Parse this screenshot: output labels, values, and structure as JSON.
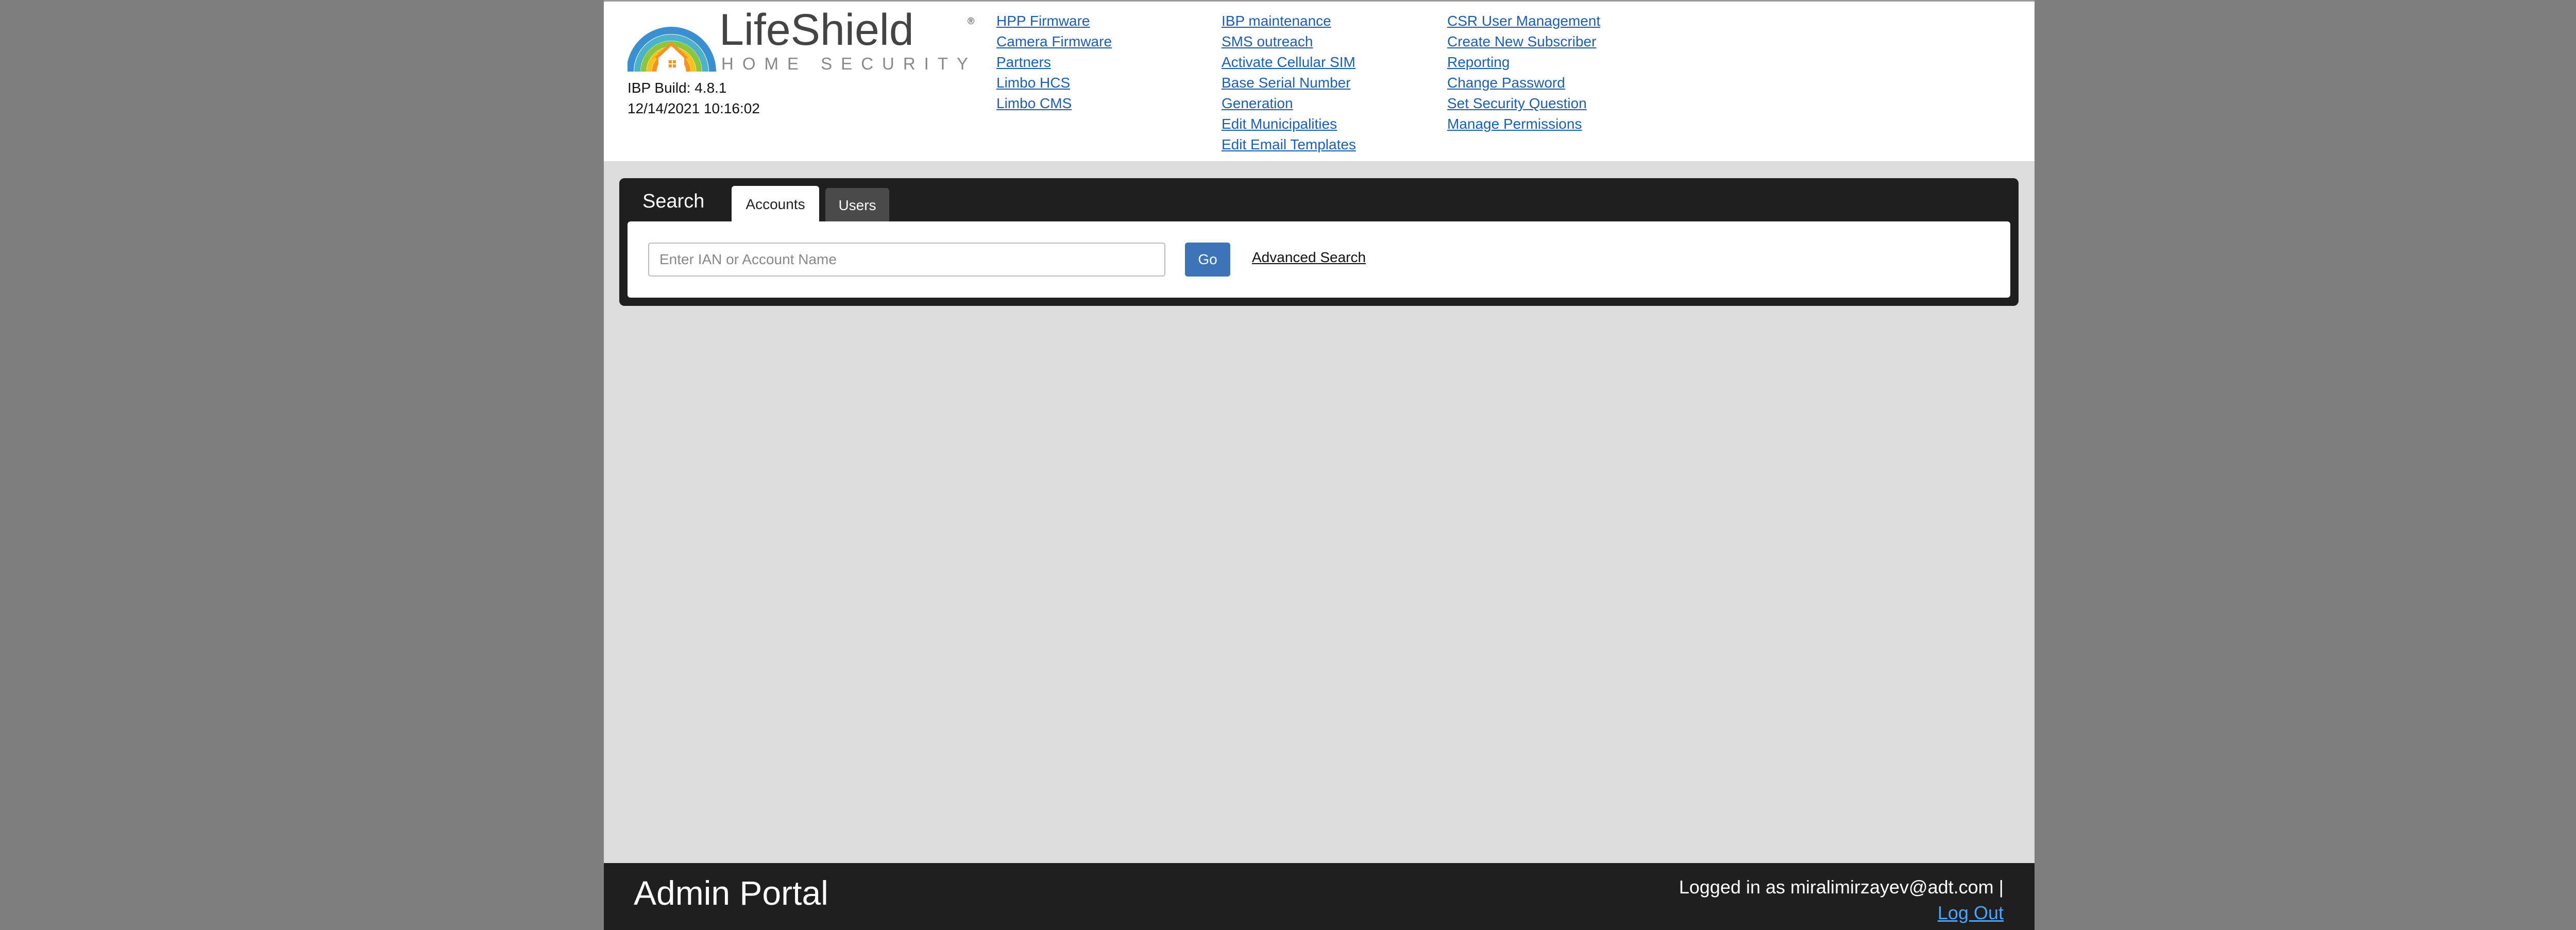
{
  "brand": {
    "name": "LifeShield",
    "tagline": "HOME SECURITY"
  },
  "build": {
    "label": "IBP Build: 4.8.1",
    "timestamp": "12/14/2021 10:16:02"
  },
  "nav": {
    "col1": [
      "HPP Firmware",
      "Camera Firmware",
      "Partners",
      "Limbo HCS",
      "Limbo CMS"
    ],
    "col2": [
      "IBP maintenance",
      "SMS outreach",
      "Activate Cellular SIM",
      "Base Serial Number",
      "Generation",
      "Edit Municipalities",
      "Edit Email Templates"
    ],
    "col3": [
      "CSR User Management",
      "Create New Subscriber",
      "Reporting",
      "Change Password",
      "Set Security Question",
      "Manage Permissions"
    ]
  },
  "search": {
    "title": "Search",
    "tabs": [
      "Accounts",
      "Users"
    ],
    "placeholder": "Enter IAN or Account Name",
    "go_label": "Go",
    "advanced_label": "Advanced Search"
  },
  "footer": {
    "title": "Admin Portal",
    "logged_in": "Logged in as miralimirzayev@adt.com |",
    "logout_label": "Log Out"
  },
  "colors": {
    "outer_background": "#7f7f7f",
    "page_background": "#dcdcdc",
    "panel_dark": "#1f1f1f",
    "link_blue": "#1a5fb4",
    "button_blue": "#3d74b8",
    "logout_blue": "#4aa3ff"
  }
}
